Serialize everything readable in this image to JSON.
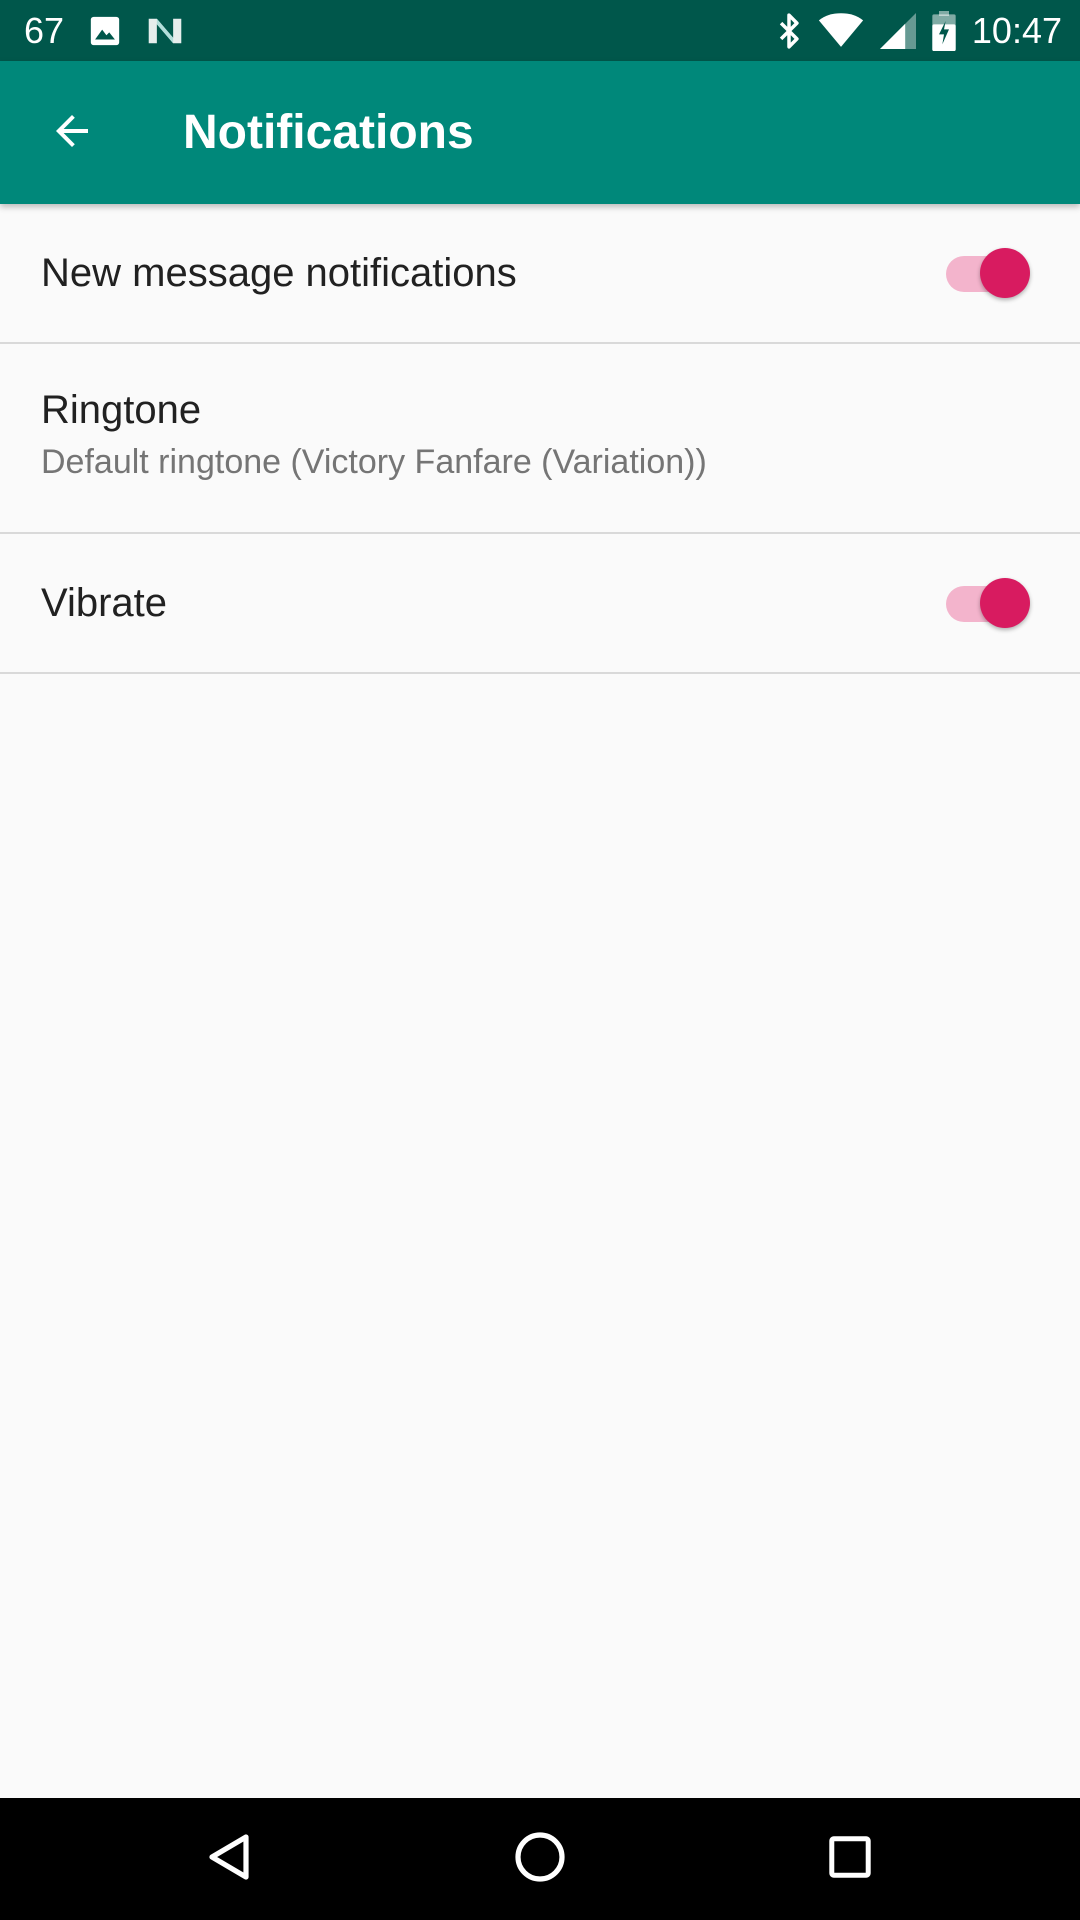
{
  "status_bar": {
    "left_text": "67",
    "time": "10:47",
    "left_icons": [
      "image-icon",
      "n-logo-icon"
    ],
    "right_icons": [
      "bluetooth-icon",
      "wifi-icon",
      "cell-signal-icon",
      "battery-charging-icon"
    ]
  },
  "app_bar": {
    "title": "Notifications",
    "back_icon": "arrow-back-icon",
    "background": "#00887a",
    "status_background": "#00574b"
  },
  "preferences": {
    "new_message": {
      "title": "New message notifications",
      "enabled": true
    },
    "ringtone": {
      "title": "Ringtone",
      "summary": "Default ringtone (Victory Fanfare (Variation))"
    },
    "vibrate": {
      "title": "Vibrate",
      "enabled": true
    }
  },
  "colors": {
    "accent": "#d81b60",
    "accent_track": "#f3b4cc",
    "divider": "#d9d9d9"
  },
  "nav_bar": {
    "icons": [
      "nav-back-icon",
      "nav-home-icon",
      "nav-recents-icon"
    ]
  }
}
